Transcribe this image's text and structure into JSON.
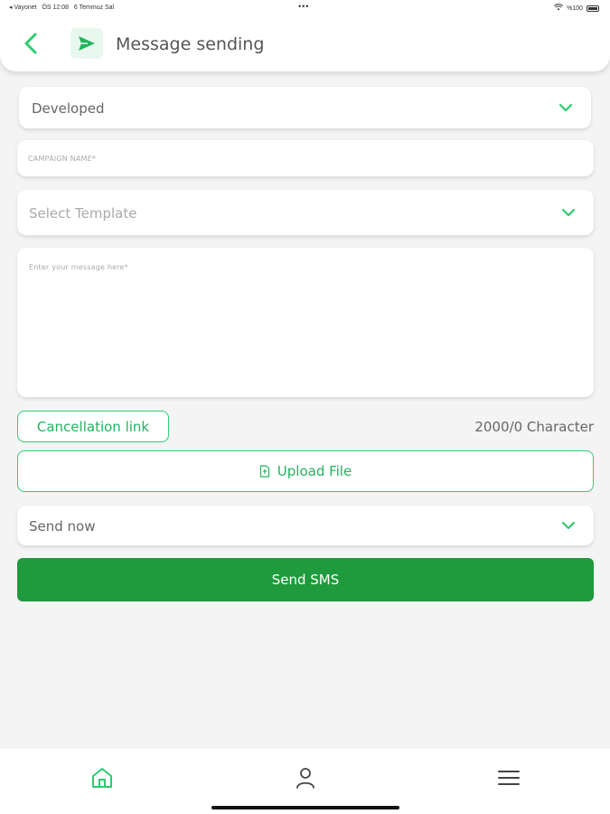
{
  "status_bar": {
    "carrier": "◂ Vayonet",
    "time": "ÖS 12:08",
    "date": "6 Temmuz Sal",
    "dots": "•••",
    "battery_text": "%100"
  },
  "header": {
    "title": "Message sending",
    "back_icon": "chevron-left-icon",
    "page_icon": "send-icon"
  },
  "form": {
    "sender_select": {
      "value": "Developed"
    },
    "campaign_name": {
      "placeholder": "CAMPAIGN NAME*"
    },
    "template_select": {
      "placeholder": "Select Template"
    },
    "message": {
      "placeholder": "Enter your message here*"
    },
    "cancellation_link_label": "Cancellation link",
    "character_count": "2000/0 Character",
    "upload_file_label": "Upload File",
    "schedule_select": {
      "value": "Send now"
    },
    "send_button_label": "Send SMS"
  },
  "bottom_nav": {
    "items": [
      {
        "name": "home",
        "icon": "home-icon",
        "active": true
      },
      {
        "name": "profile",
        "icon": "user-icon",
        "active": false
      },
      {
        "name": "menu",
        "icon": "menu-icon",
        "active": false
      }
    ]
  },
  "colors": {
    "accent": "#2ecc71",
    "primary_button": "#1f9a3d",
    "background": "#f4f4f4"
  }
}
